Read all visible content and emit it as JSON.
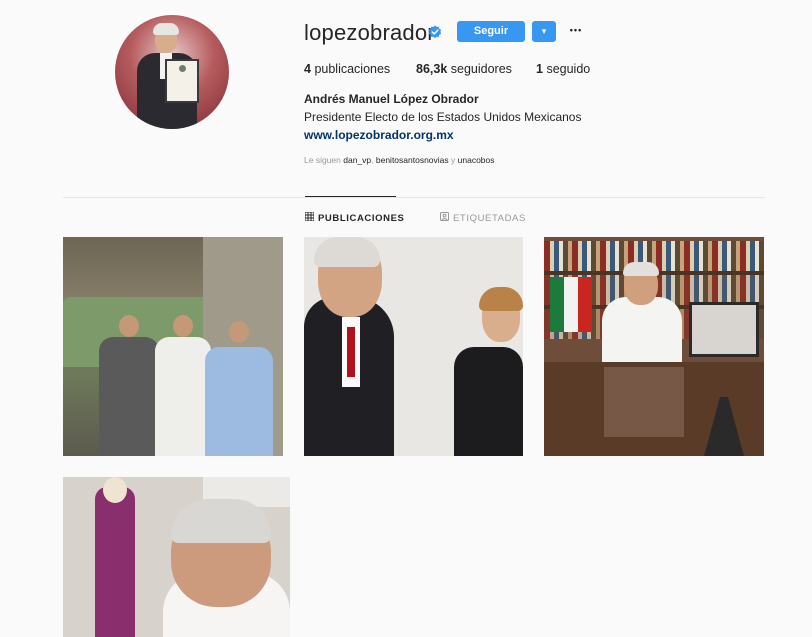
{
  "profile": {
    "username": "lopezobrador",
    "verified": true,
    "follow_label": "Seguir",
    "dropdown_icon": "▾",
    "more_icon": "•••",
    "stats": {
      "posts_count": "4",
      "posts_label": "publicaciones",
      "followers_count": "86,3k",
      "followers_label": "seguidores",
      "following_count": "1",
      "following_label": "seguido"
    },
    "full_name": "Andrés Manuel López Obrador",
    "bio": "Presidente Electo de los Estados Unidos Mexicanos",
    "website": "www.lopezobrador.org.mx",
    "followed_by": {
      "prefix": "Le siguen",
      "accounts": [
        "dan_vp",
        "benitosantosnovias",
        "unacobos"
      ],
      "separator": ", ",
      "conjunction": " y "
    }
  },
  "tabs": [
    {
      "label": "PUBLICACIONES",
      "icon": "grid-icon",
      "active": true
    },
    {
      "label": "ETIQUETADAS",
      "icon": "tagged-icon",
      "active": false
    }
  ],
  "colors": {
    "accent": "#3897f0",
    "link": "#003569",
    "verified_badge": "#3897f0",
    "background": "#fafafa"
  },
  "posts": [
    {
      "subject": "group-photo-ruins"
    },
    {
      "subject": "conversation-portrait"
    },
    {
      "subject": "office-desk-flag"
    },
    {
      "subject": "portrait-with-catrina"
    }
  ]
}
